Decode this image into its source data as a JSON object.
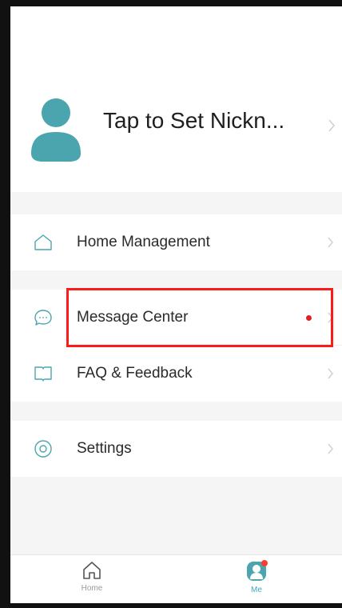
{
  "profile": {
    "nickname": "Tap to Set Nickn..."
  },
  "menu": {
    "items": [
      {
        "id": "home-management",
        "label": "Home Management",
        "icon": "house-icon"
      },
      {
        "id": "message-center",
        "label": "Message Center",
        "icon": "chat-bubble-icon",
        "unread": true
      },
      {
        "id": "faq-feedback",
        "label": "FAQ & Feedback",
        "icon": "book-icon"
      },
      {
        "id": "settings",
        "label": "Settings",
        "icon": "settings-icon"
      }
    ]
  },
  "tabbar": {
    "home_label": "Home",
    "me_label": "Me",
    "active": "me"
  },
  "colors": {
    "accent": "#3fa8b3",
    "avatar": "#4aa5ae",
    "badge": "#e02020",
    "highlight": "#ff1a1a"
  }
}
